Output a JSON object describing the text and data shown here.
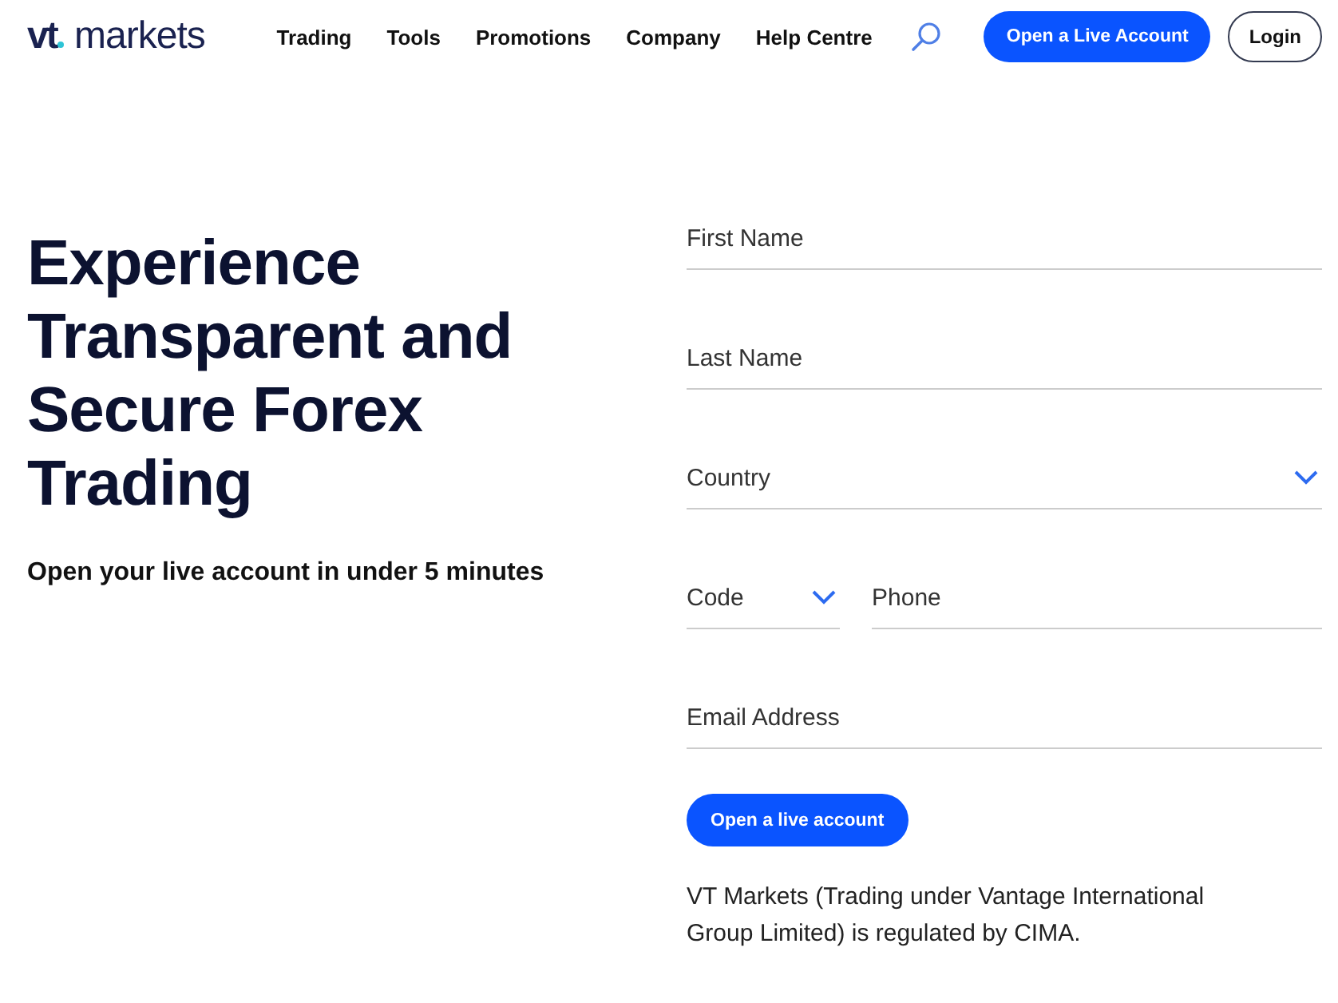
{
  "header": {
    "logo": {
      "bold": "vt",
      "light": "markets"
    },
    "nav": [
      "Trading",
      "Tools",
      "Promotions",
      "Company",
      "Help Centre"
    ],
    "primary_button": "Open a Live Account",
    "login_button": "Login"
  },
  "hero": {
    "title": "Experience Transparent and Secure Forex Trading",
    "subtitle": "Open your live account in under 5 minutes"
  },
  "form": {
    "rows": [
      [
        {
          "kind": "text",
          "placeholder": "First Name"
        }
      ],
      [
        {
          "kind": "text",
          "placeholder": "Last Name"
        }
      ],
      [
        {
          "kind": "select",
          "placeholder": "Country"
        }
      ],
      [
        {
          "kind": "select",
          "placeholder": "Code"
        },
        {
          "kind": "text",
          "placeholder": "Phone"
        }
      ],
      [
        {
          "kind": "text",
          "placeholder": "Email Address"
        }
      ]
    ],
    "submit": "Open a live account",
    "disclaimer": "VT Markets (Trading under Vantage International Group Limited) is regulated by CIMA."
  }
}
